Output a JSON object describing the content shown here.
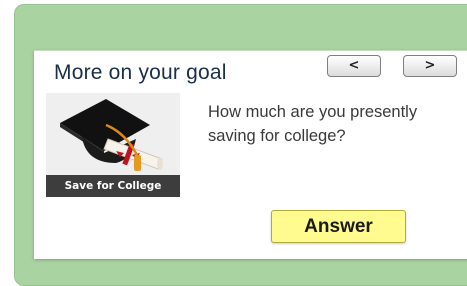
{
  "card": {
    "title": "More on your goal",
    "prev_label": "<",
    "next_label": ">",
    "thumbnail_caption": "Save for College",
    "question": "How much are you presently saving for college?",
    "answer_label": "Answer"
  },
  "colors": {
    "panel_green": "#a9d3a1",
    "answer_yellow": "#fffb8e",
    "title_blue": "#1a2f4a"
  },
  "icons": {
    "thumbnail": "graduation-cap-diploma-icon"
  }
}
